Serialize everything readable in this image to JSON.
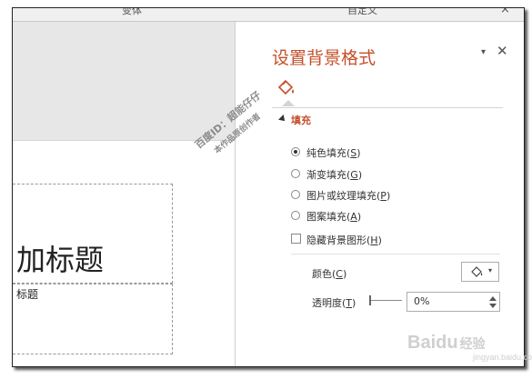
{
  "top_strip": {
    "left_label": "变体",
    "right_label": "自定义",
    "close_glyph": "×"
  },
  "slide": {
    "title_text": "加标题",
    "subtitle_text": "标题"
  },
  "pane": {
    "title": "设置背景格式",
    "dropdown_glyph": "▾",
    "close_glyph": "✕",
    "section_title": "填充",
    "fill_options": [
      {
        "label_pre": "纯色填充(",
        "accel": "S",
        "label_post": ")",
        "selected": true
      },
      {
        "label_pre": "渐变填充(",
        "accel": "G",
        "label_post": ")",
        "selected": false
      },
      {
        "label_pre": "图片或纹理填充(",
        "accel": "P",
        "label_post": ")",
        "selected": false
      },
      {
        "label_pre": "图案填充(",
        "accel": "A",
        "label_post": ")",
        "selected": false
      }
    ],
    "hide_bg_graphics": {
      "label_pre": "隐藏背景图形(",
      "accel": "H",
      "label_post": ")",
      "checked": false
    },
    "color": {
      "label_pre": "颜色(",
      "accel": "C",
      "label_post": ")",
      "dropdown_glyph": "▾"
    },
    "transparency": {
      "label_pre": "透明度(",
      "accel": "T",
      "label_post": ")",
      "value": "0%",
      "level": 0
    }
  },
  "watermark": {
    "line1": "百度ID：超能仔仔",
    "line2": "本作品原创作者"
  },
  "baidu_watermark": {
    "brand_a": "Bai",
    "brand_b": "du",
    "suffix": "经验",
    "url": "jingyan.baidu.com"
  },
  "colors": {
    "accent": "#c4502a"
  }
}
